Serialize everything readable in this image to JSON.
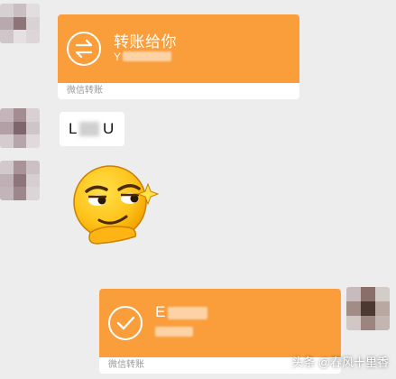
{
  "messages": [
    {
      "type": "transfer",
      "side": "left",
      "title": "转账给你",
      "subtitle": "Y",
      "footer": "微信转账"
    },
    {
      "type": "text",
      "side": "left",
      "text_start": "L",
      "text_end": "U"
    },
    {
      "type": "sticker",
      "side": "left",
      "sticker": "smirk-emoji"
    },
    {
      "type": "transfer",
      "side": "right",
      "title": "E",
      "subtitle": "",
      "footer": "微信转账"
    }
  ],
  "watermark": "头条 @春风十里香",
  "colors": {
    "transfer_orange": "#fa9d3b",
    "chat_background": "#ededed"
  }
}
